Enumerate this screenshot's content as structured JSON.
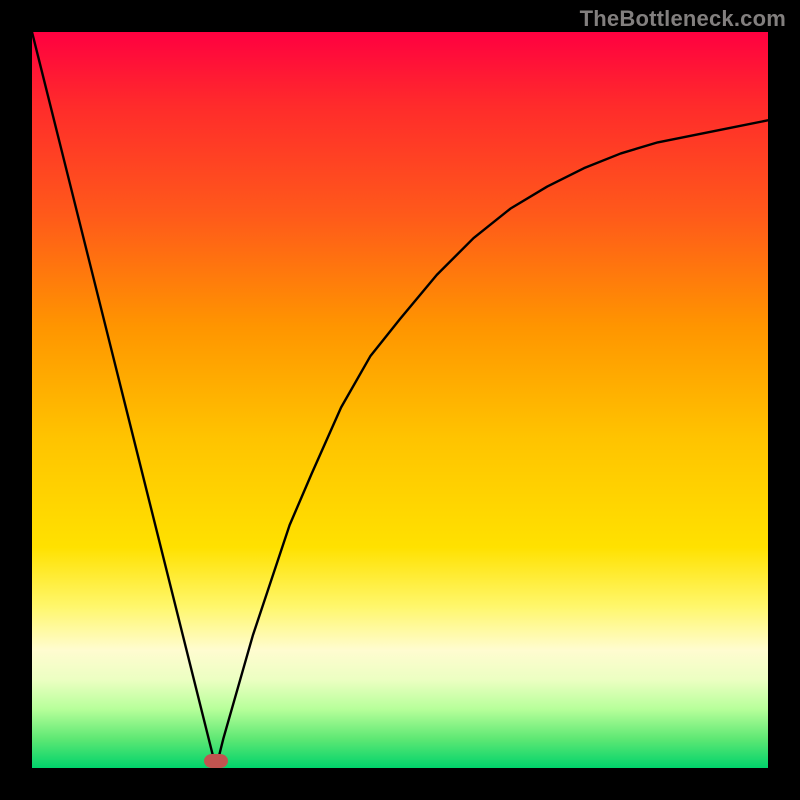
{
  "watermark": "TheBottleneck.com",
  "colors": {
    "frame": "#000000",
    "curve": "#000000",
    "marker": "#c25450"
  },
  "chart_data": {
    "type": "line",
    "title": "",
    "xlabel": "",
    "ylabel": "",
    "xlim": [
      0,
      100
    ],
    "ylim": [
      0,
      100
    ],
    "grid": false,
    "notes": "Single black curve on a vertical red→green gradient background. The function plummets from the top-left, reaches zero near x≈25, then rises with decreasing slope toward the upper right, leveling off around y≈88. A small rounded maroon marker sits at the valley bottom (approx x=25, y=1). No axes, ticks, legend, or numeric labels are visible.",
    "series": [
      {
        "name": "curve",
        "x": [
          0,
          4,
          8,
          12,
          16,
          20,
          24,
          25,
          26,
          28,
          30,
          32,
          35,
          38,
          42,
          46,
          50,
          55,
          60,
          65,
          70,
          75,
          80,
          85,
          90,
          95,
          100
        ],
        "values": [
          100,
          84,
          68,
          52,
          36,
          20,
          4,
          0,
          4,
          11,
          18,
          24,
          33,
          40,
          49,
          56,
          61,
          67,
          72,
          76,
          79,
          81.5,
          83.5,
          85,
          86,
          87,
          88
        ]
      }
    ],
    "marker": {
      "x": 25,
      "y": 1
    }
  }
}
